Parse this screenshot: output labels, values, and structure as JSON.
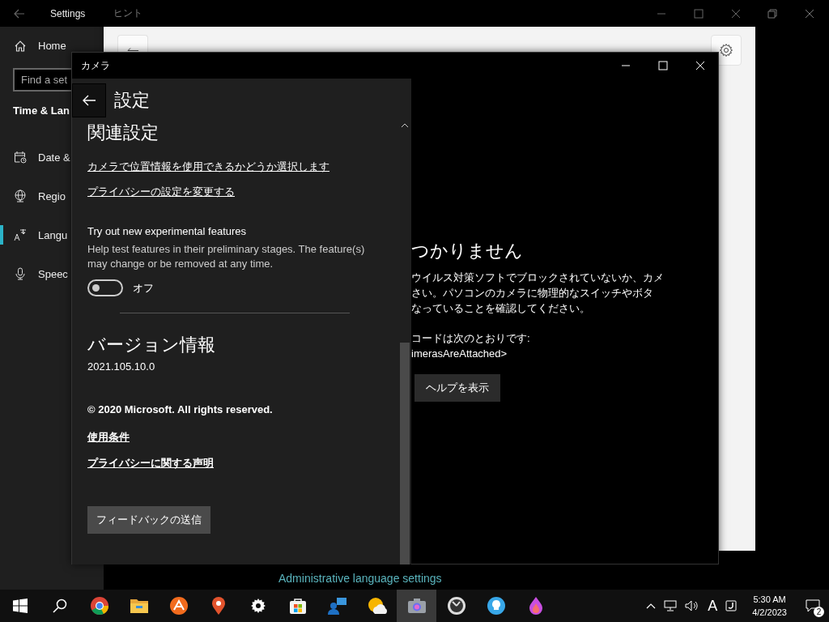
{
  "settings_window": {
    "title": "Settings",
    "home": "Home",
    "search": {
      "placeholder": "Find a set"
    },
    "section_title": "Time & Lan",
    "items": [
      {
        "kind": "calendar",
        "label": "Date &",
        "selected": false
      },
      {
        "kind": "globe",
        "label": "Regio",
        "selected": false
      },
      {
        "kind": "language",
        "label": "Langu",
        "selected": true
      },
      {
        "kind": "mic",
        "label": "Speec",
        "selected": false
      }
    ],
    "link": "Administrative language settings"
  },
  "hint_window": {
    "title": "ヒント"
  },
  "camera_window": {
    "title": "カメラ",
    "settings_panel": {
      "title": "設定",
      "related_heading": "関連設定",
      "links": [
        "カメラで位置情報を使用できるかどうか選択します",
        "プライバシーの設定を変更する"
      ],
      "experimental": {
        "title": "Try out new experimental features",
        "description": "Help test features in their preliminary stages. The feature(s) may change or be removed at any time.",
        "toggle": {
          "on": false,
          "label": "オフ"
        }
      },
      "version_heading": "バージョン情報",
      "version": "2021.105.10.0",
      "copyright": "© 2020 Microsoft. All rights reserved.",
      "legal_links": [
        "使用条件",
        "プライバシーに関する声明"
      ],
      "feedback_button": "フィードバックの送信"
    },
    "error": {
      "heading": "つかりません",
      "lines": [
        "ウイルス対策ソフトでブロックされていないか、カメ",
        "さい。パソコンのカメラに物理的なスイッチやボタ",
        "なっていることを確認してください。"
      ],
      "code_label": "コードは次のとおりです:",
      "code": "imerasAreAttached>",
      "help_button": "ヘルプを表示"
    }
  },
  "taskbar": {
    "apps": [
      {
        "kind": "start",
        "selected": false
      },
      {
        "kind": "search",
        "selected": false
      },
      {
        "kind": "chrome",
        "selected": false
      },
      {
        "kind": "folder",
        "selected": false
      },
      {
        "kind": "sparkle",
        "selected": false
      },
      {
        "kind": "pin",
        "selected": false
      },
      {
        "kind": "gear",
        "selected": false
      },
      {
        "kind": "store",
        "selected": false
      },
      {
        "kind": "people",
        "selected": false
      },
      {
        "kind": "weather",
        "selected": false
      },
      {
        "kind": "camera",
        "selected": true
      },
      {
        "kind": "clock",
        "selected": false
      },
      {
        "kind": "bulb",
        "selected": false
      },
      {
        "kind": "flame",
        "selected": false
      }
    ],
    "ime_label": "A",
    "time": "5:30 AM",
    "date": "4/2/2023",
    "notification_count": "2"
  }
}
